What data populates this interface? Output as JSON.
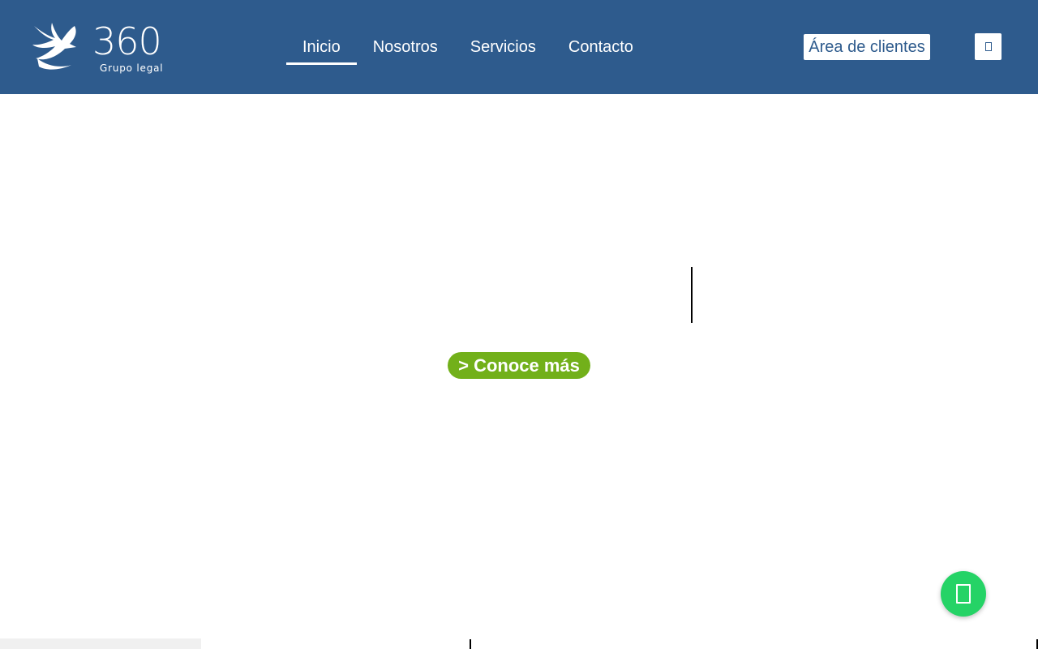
{
  "brand": {
    "logo_number": "360",
    "logo_subtitle": "Grupo legal"
  },
  "nav": {
    "items": [
      {
        "label": "Inicio",
        "active": true
      },
      {
        "label": "Nosotros",
        "active": false
      },
      {
        "label": "Servicios",
        "active": false
      },
      {
        "label": "Contacto",
        "active": false
      }
    ]
  },
  "header": {
    "client_area_label": "Área de clientes",
    "menu_icon": "menu-icon"
  },
  "hero": {
    "cta_label": "> Conoce más"
  },
  "floating": {
    "whatsapp_icon": "whatsapp-icon"
  },
  "colors": {
    "header_bg": "#2e5b8d",
    "cta_bg": "#72b01a",
    "whatsapp_bg": "#25d366",
    "text_light": "#ffffff"
  }
}
